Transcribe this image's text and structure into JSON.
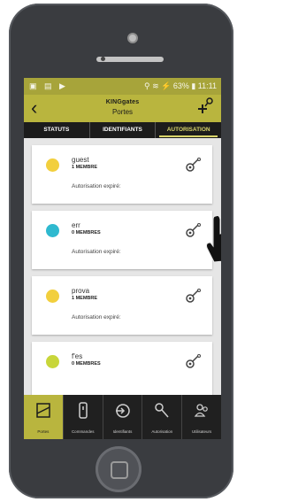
{
  "status_bar": {
    "left_icons": "▣ ▤ ▶",
    "right_text": "⚲ ≋ ⚡ 63% ▮ 11:11"
  },
  "app": {
    "brand": "KINGgates",
    "subtitle": "Portes",
    "back_icon": "back-arrow-icon",
    "add_icon": "add-key-icon"
  },
  "tabs": [
    {
      "label": "STATUTS",
      "active": false
    },
    {
      "label": "IDENTIFIANTS",
      "active": false
    },
    {
      "label": "AUTORISATION",
      "active": true
    }
  ],
  "cards": [
    {
      "name": "guest",
      "members": "1 MEMBRE",
      "auth": "Autorisation expiré:",
      "color": "#f2cf3d"
    },
    {
      "name": "err",
      "members": "0 MEMBRES",
      "auth": "Autorisation expiré:",
      "color": "#2fb9cf"
    },
    {
      "name": "prova",
      "members": "1 MEMBRE",
      "auth": "Autorisation expiré:",
      "color": "#f2cf3d"
    },
    {
      "name": "f'es",
      "members": "0 MEMBRES",
      "auth": "",
      "color": "#c8d63a"
    }
  ],
  "bottom_nav": [
    {
      "label": "Portes",
      "icon": "gate-icon",
      "active": true
    },
    {
      "label": "Commandes",
      "icon": "remote-icon",
      "active": false
    },
    {
      "label": "Identifiants",
      "icon": "login-icon",
      "active": false
    },
    {
      "label": "Autorisation",
      "icon": "key-icon",
      "active": false
    },
    {
      "label": "Utilisateurs",
      "icon": "users-icon",
      "active": false
    }
  ],
  "colors": {
    "accent": "#b9b53e",
    "dark": "#1c1c1c"
  }
}
